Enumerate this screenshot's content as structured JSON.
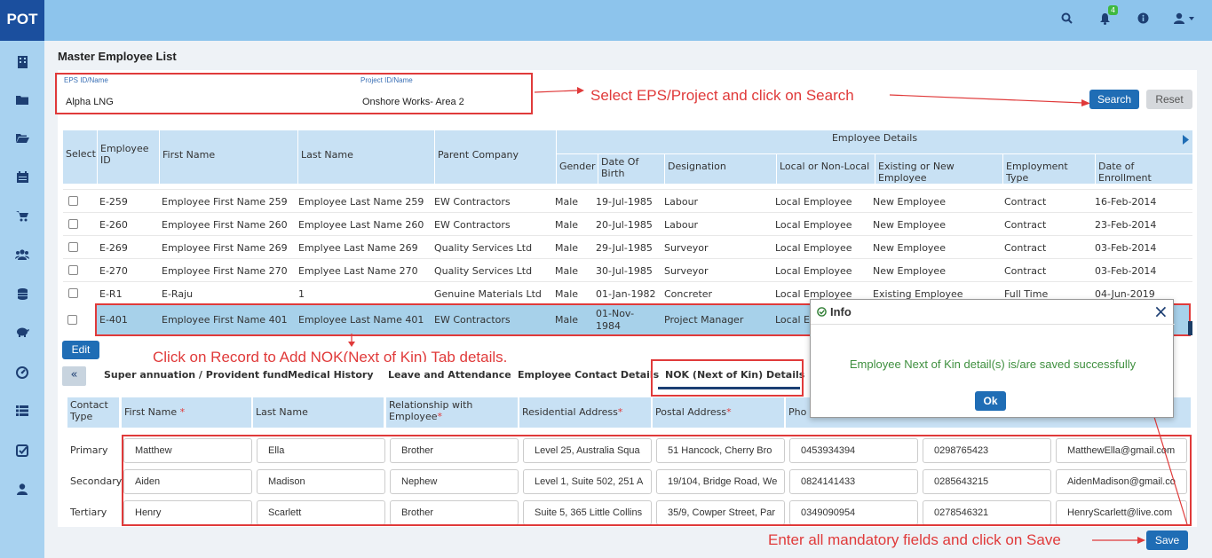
{
  "app": {
    "logo": "POT"
  },
  "topbar": {
    "notification_count": "4"
  },
  "page": {
    "title": "Master Employee List"
  },
  "filters": {
    "eps_label": "EPS ID/Name",
    "eps_value": "Alpha LNG",
    "project_label": "Project ID/Name",
    "project_value": "Onshore  Works- Area 2",
    "search_label": "Search",
    "reset_label": "Reset"
  },
  "annotations": {
    "search_note": "Select EPS/Project and click on Search",
    "record_note": "Click on Record to Add NOK(Next of Kin) Tab details.",
    "save_note": "Enter all mandatory fields and click on Save"
  },
  "employee_table": {
    "group_header": "Employee Details",
    "columns": {
      "select": "Select",
      "employee_id": "Employee ID",
      "first_name": "First Name",
      "last_name": "Last Name",
      "parent_company": "Parent Company",
      "gender": "Gender",
      "dob": "Date Of Birth",
      "designation": "Designation",
      "local": "Local or Non-Local",
      "existing": "Existing or New Employee",
      "emp_type": "Employment Type",
      "enrollment": "Date of Enrollment"
    },
    "rows": [
      {
        "id": "E-259",
        "first": "Employee First Name 259",
        "last": "Employee Last Name 259",
        "company": "EW Contractors",
        "gender": "Male",
        "dob": "19-Jul-1985",
        "designation": "Labour",
        "local": "Local Employee",
        "existing": "New Employee",
        "type": "Contract",
        "enroll": "16-Feb-2014"
      },
      {
        "id": "E-260",
        "first": "Employee First Name 260",
        "last": "Employee Last Name 260",
        "company": "EW Contractors",
        "gender": "Male",
        "dob": "20-Jul-1985",
        "designation": "Labour",
        "local": "Local Employee",
        "existing": "New Employee",
        "type": "Contract",
        "enroll": "23-Feb-2014"
      },
      {
        "id": "E-269",
        "first": "Employee First Name 269",
        "last": "Emplyee Last Name 269",
        "company": "Quality Services Ltd",
        "gender": "Male",
        "dob": "29-Jul-1985",
        "designation": "Surveyor",
        "local": "Local Employee",
        "existing": "New Employee",
        "type": "Contract",
        "enroll": "03-Feb-2014"
      },
      {
        "id": "E-270",
        "first": "Employee First Name 270",
        "last": "Emplyee Last Name 270",
        "company": "Quality Services Ltd",
        "gender": "Male",
        "dob": "30-Jul-1985",
        "designation": "Surveyor",
        "local": "Local Employee",
        "existing": "New Employee",
        "type": "Contract",
        "enroll": "03-Feb-2014"
      },
      {
        "id": "E-R1",
        "first": "E-Raju",
        "last": "1",
        "company": "Genuine Materials Ltd",
        "gender": "Male",
        "dob": "01-Jan-1982",
        "designation": "Concreter",
        "local": "Local Employee",
        "existing": "Existing Employee",
        "type": "Full Time",
        "enroll": "04-Jun-2019"
      }
    ],
    "selected_row": {
      "id": "E-401",
      "first": "Employee First Name 401",
      "last": "Employee Last Name 401",
      "company": "EW Contractors",
      "gender": "Male",
      "dob": "01-Nov-1984",
      "designation": "Project Manager",
      "local": "Local E"
    },
    "edit_label": "Edit"
  },
  "tabs": {
    "items": [
      "Super annuation / Provident fund",
      "Medical History",
      "Leave and Attendance",
      "Employee Contact Details",
      "NOK (Next of Kin) Details"
    ],
    "active": "NOK (Next of Kin) Details"
  },
  "nok_table": {
    "columns": {
      "contact_type": "Contact Type",
      "first_name": "First Name",
      "last_name": "Last Name",
      "relationship": "Relationship with Employee",
      "residential": "Residential Address",
      "postal": "Postal Address",
      "phone": "Pho"
    },
    "required_mark": "*",
    "rows": [
      {
        "type": "Primary",
        "first": "Matthew",
        "last": "Ella",
        "rel": "Brother",
        "res": "Level 25, Australia Squa",
        "postal": "51 Hancock, Cherry Bro",
        "phone": "0453934394",
        "phone2": "0298765423",
        "email": "MatthewElla@gmail.com"
      },
      {
        "type": "Secondary",
        "first": "Aiden",
        "last": "Madison",
        "rel": "Nephew",
        "res": "Level 1, Suite 502, 251 A",
        "postal": "19/104, Bridge Road, We",
        "phone": "0824141433",
        "phone2": "0285643215",
        "email": "AidenMadison@gmail.co"
      },
      {
        "type": "Tertiary",
        "first": "Henry",
        "last": "Scarlett",
        "rel": "Brother",
        "res": "Suite 5, 365 Little Collins",
        "postal": "35/9, Cowper Street, Par",
        "phone": "0349090954",
        "phone2": "0278546321",
        "email": "HenryScarlett@live.com"
      }
    ],
    "save_label": "Save"
  },
  "modal": {
    "title": "Info",
    "message": "Employee Next of Kin detail(s) is/are saved successfully",
    "ok_label": "Ok"
  }
}
